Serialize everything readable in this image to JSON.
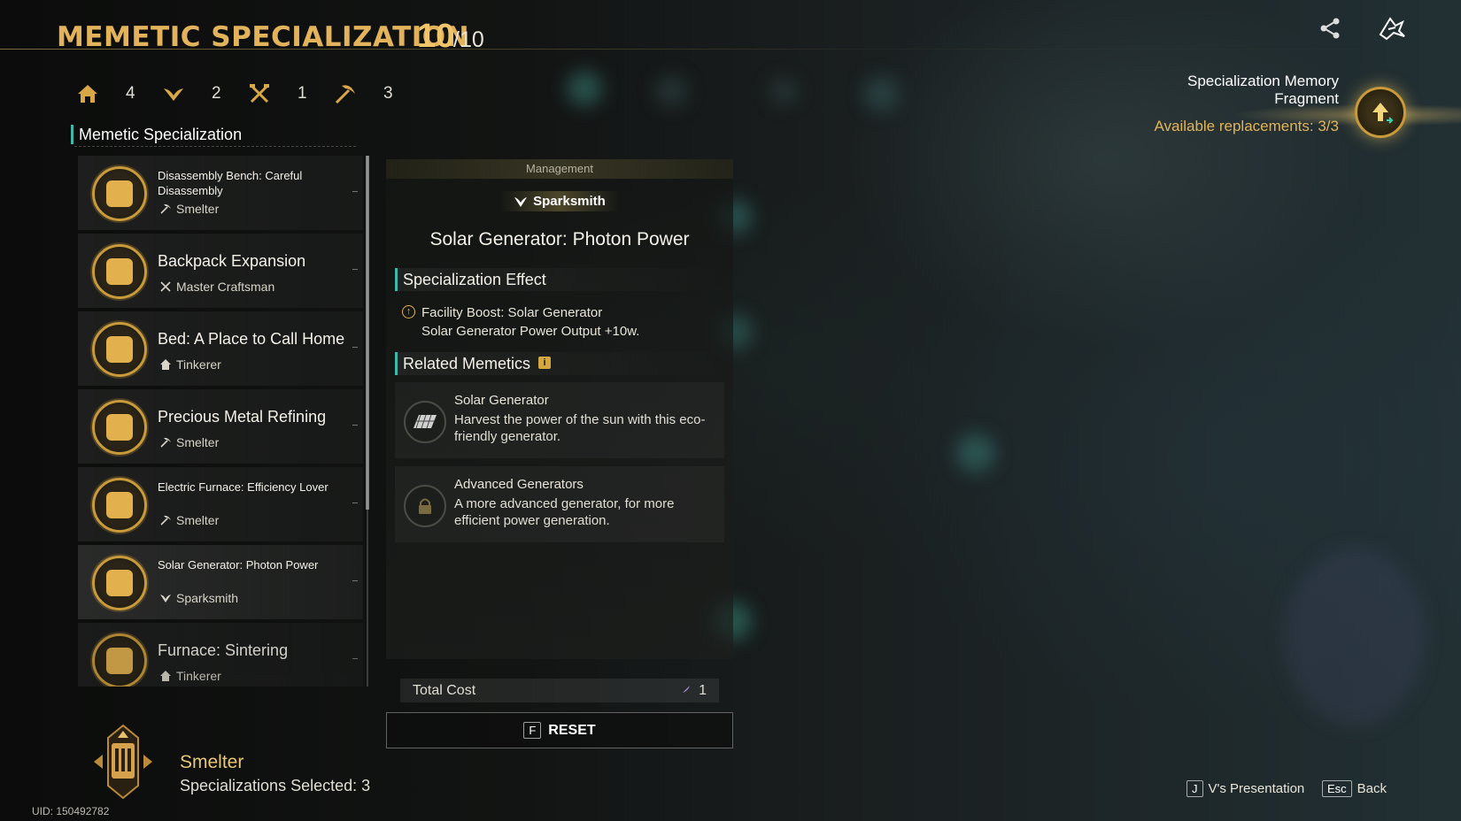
{
  "header": {
    "title": "MEMETIC SPECIALIZATION",
    "score": "10",
    "score_total": "/10"
  },
  "stats": [
    {
      "icon": "home-icon",
      "value": "4"
    },
    {
      "icon": "wings-icon",
      "value": "2"
    },
    {
      "icon": "crossed-tools-icon",
      "value": "1"
    },
    {
      "icon": "pickaxe-icon",
      "value": "3"
    }
  ],
  "list": {
    "heading": "Memetic Specialization",
    "items": [
      {
        "title": "Disassembly Bench: Careful Disassembly",
        "profession": "Smelter",
        "prof_icon": "pickaxe-icon",
        "small": true
      },
      {
        "title": "Backpack Expansion",
        "profession": "Master Craftsman",
        "prof_icon": "crossed-tools-icon",
        "small": false
      },
      {
        "title": "Bed: A Place to Call Home",
        "profession": "Tinkerer",
        "prof_icon": "home-icon",
        "small": false
      },
      {
        "title": "Precious Metal Refining",
        "profession": "Smelter",
        "prof_icon": "pickaxe-icon",
        "small": false
      },
      {
        "title": "Electric Furnace: Efficiency Lover",
        "profession": "Smelter",
        "prof_icon": "pickaxe-icon",
        "small": true
      },
      {
        "title": "Solar Generator: Photon Power",
        "profession": "Sparksmith",
        "prof_icon": "wings-icon",
        "small": true,
        "selected": true
      },
      {
        "title": "Furnace: Sintering",
        "profession": "Tinkerer",
        "prof_icon": "home-icon",
        "small": false
      }
    ]
  },
  "profession": {
    "name": "Smelter",
    "selected": "Specializations Selected: 3"
  },
  "uid": "UID: 150492782",
  "detail": {
    "category": "Management",
    "tag": "Sparksmith",
    "title": "Solar Generator: Photon Power",
    "effect_heading": "Specialization Effect",
    "effect_title": "Facility Boost: Solar Generator",
    "effect_desc": "Solar Generator Power Output +10w.",
    "related_heading": "Related Memetics",
    "related": [
      {
        "title": "Solar Generator",
        "desc": "Harvest the power of the sun with this eco-friendly generator.",
        "icon": "solar-panel-icon"
      },
      {
        "title": "Advanced Generators",
        "desc": "A more advanced generator, for more efficient power generation.",
        "icon": "lock-icon"
      }
    ],
    "cost_label": "Total Cost",
    "cost_value": "1",
    "reset_key": "F",
    "reset_label": "RESET"
  },
  "fragment": {
    "title_line1": "Specialization Memory",
    "title_line2": "Fragment",
    "available": "Available replacements: 3/3"
  },
  "hints": {
    "presentation_key": "J",
    "presentation_label": "V's Presentation",
    "back_key": "Esc",
    "back_label": "Back"
  },
  "colors": {
    "gold": "#e2b35b",
    "teal_accent": "#3fb7a9"
  }
}
